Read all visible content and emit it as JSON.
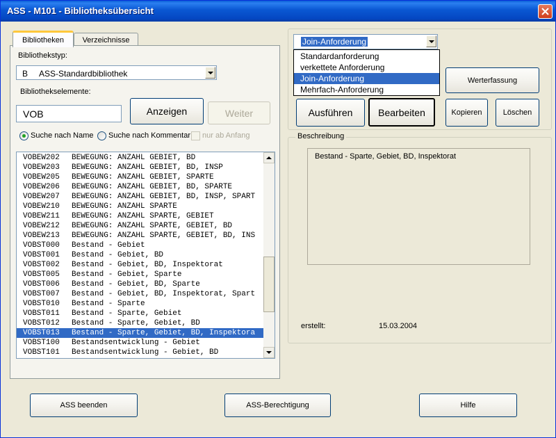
{
  "window": {
    "title": "ASS - M101 - Bibliotheksübersicht"
  },
  "tabs": [
    {
      "label": "Bibliotheken"
    },
    {
      "label": "Verzeichnisse"
    }
  ],
  "library_type": {
    "label": "Bibliothekstyp:",
    "value": "B     ASS-Standardbibliothek"
  },
  "elements": {
    "label": "Bibliothekselemente:",
    "input_value": "VOB"
  },
  "buttons": {
    "show": "Anzeigen",
    "next": "Weiter",
    "execute": "Ausführen",
    "edit": "Bearbeiten",
    "value_entry": "Werterfassung",
    "copy": "Kopieren",
    "delete": "Löschen",
    "exit": "ASS beenden",
    "permission": "ASS-Berechtigung",
    "help": "Hilfe"
  },
  "search": {
    "by_name": "Suche nach Name",
    "by_comment": "Suche nach Kommentar",
    "from_start": "nur ab Anfang"
  },
  "list": {
    "items": [
      {
        "code": "VOBEW202",
        "text": "BEWEGUNG: ANZAHL GEBIET, BD"
      },
      {
        "code": "VOBEW203",
        "text": "BEWEGUNG: ANZAHL GEBIET, BD, INSP"
      },
      {
        "code": "VOBEW205",
        "text": "BEWEGUNG: ANZAHL GEBIET, SPARTE"
      },
      {
        "code": "VOBEW206",
        "text": "BEWEGUNG: ANZAHL GEBIET, BD, SPARTE"
      },
      {
        "code": "VOBEW207",
        "text": "BEWEGUNG: ANZAHL GEBIET, BD, INSP, SPART"
      },
      {
        "code": "VOBEW210",
        "text": "BEWEGUNG: ANZAHL SPARTE"
      },
      {
        "code": "VOBEW211",
        "text": "BEWEGUNG: ANZAHL SPARTE, GEBIET"
      },
      {
        "code": "VOBEW212",
        "text": "BEWEGUNG: ANZAHL SPARTE, GEBIET, BD"
      },
      {
        "code": "VOBEW213",
        "text": "BEWEGUNG: ANZAHL SPARTE, GEBIET, BD, INS"
      },
      {
        "code": "VOBST000",
        "text": "Bestand - Gebiet"
      },
      {
        "code": "VOBST001",
        "text": "Bestand - Gebiet, BD"
      },
      {
        "code": "VOBST002",
        "text": "Bestand - Gebiet, BD, Inspektorat"
      },
      {
        "code": "VOBST005",
        "text": "Bestand - Gebiet, Sparte"
      },
      {
        "code": "VOBST006",
        "text": "Bestand - Gebiet, BD, Sparte"
      },
      {
        "code": "VOBST007",
        "text": "Bestand - Gebiet, BD, Inspektorat, Spart"
      },
      {
        "code": "VOBST010",
        "text": "Bestand - Sparte"
      },
      {
        "code": "VOBST011",
        "text": "Bestand - Sparte, Gebiet"
      },
      {
        "code": "VOBST012",
        "text": "Bestand - Sparte, Gebiet, BD"
      },
      {
        "code": "VOBST013",
        "text": "Bestand - Sparte, Gebiet, BD, Inspektora"
      },
      {
        "code": "VOBST100",
        "text": "Bestandsentwicklung - Gebiet"
      },
      {
        "code": "VOBST101",
        "text": "Bestandsentwicklung - Gebiet, BD"
      }
    ],
    "selected_index": 18
  },
  "request_type": {
    "value": "Join-Anforderung",
    "options": [
      "Standardanforderung",
      "verkettete Anforderung",
      "Join-Anforderung",
      "Mehrfach-Anforderung"
    ],
    "selected_index": 2
  },
  "description": {
    "legend": "Beschreibung",
    "text": "Bestand - Sparte, Gebiet, BD, Inspektorat",
    "created_label": "erstellt:",
    "created_value": "15.03.2004"
  },
  "colors": {
    "titlebar": "#0a58d3",
    "selection": "#316ac5",
    "face": "#ece9d8"
  }
}
